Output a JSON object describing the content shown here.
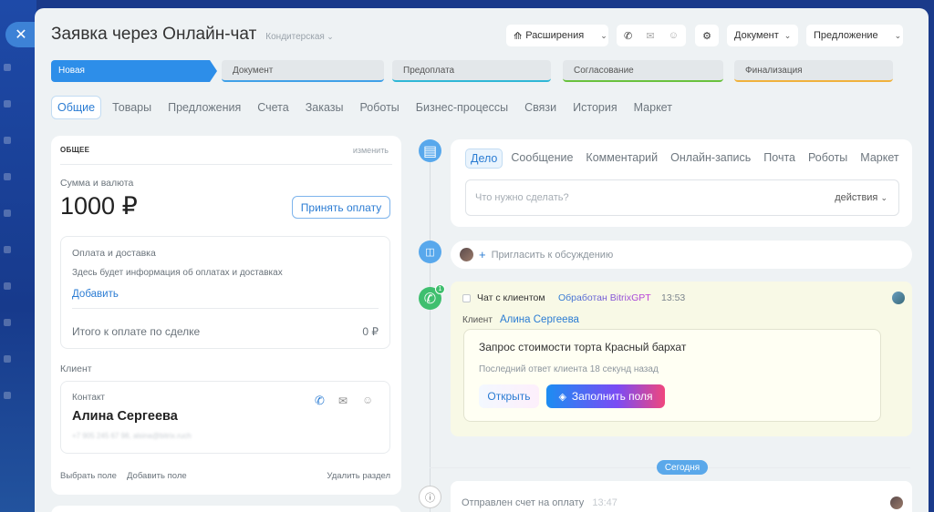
{
  "window": {
    "title": "Заявка через Онлайн-чат",
    "category": "Кондитерская"
  },
  "toolbar": {
    "extensions": "Расширения",
    "document": "Документ",
    "proposal": "Предложение"
  },
  "stages": [
    "Новая",
    "Документ",
    "Предоплата",
    "Согласование",
    "Финализация"
  ],
  "stage_colors": [
    "#2d8ee9",
    "#3fa0e8",
    "#2fb7d6",
    "#69c23d",
    "#f0b23c"
  ],
  "tabs": [
    "Общие",
    "Товары",
    "Предложения",
    "Счета",
    "Заказы",
    "Роботы",
    "Бизнес-процессы",
    "Связи",
    "История",
    "Маркет"
  ],
  "left": {
    "section_title": "ОБЩЕЕ",
    "edit_label": "изменить",
    "amount_label": "Сумма и валюта",
    "amount": "1000 ₽",
    "accept_payment": "Принять оплату",
    "payment_title": "Оплата и доставка",
    "payment_info": "Здесь будет информация об оплатах и доставках",
    "add_link": "Добавить",
    "total_label": "Итого к оплате по сделке",
    "total_value": "0 ₽",
    "client_label": "Клиент",
    "contact_label": "Контакт",
    "contact_name": "Алина Сергеева",
    "contact_details": "+7 905 245 67 98, alsina@bitrix.ruch",
    "choose_field": "Выбрать поле",
    "add_field": "Добавить поле",
    "delete_section": "Удалить раздел"
  },
  "activity": {
    "tabs": [
      "Дело",
      "Сообщение",
      "Комментарий",
      "Онлайн-запись",
      "Почта",
      "Роботы",
      "Маркет"
    ],
    "todo_placeholder": "Что нужно сделать?",
    "actions_label": "действия",
    "invite_label": "Пригласить к обсуждению"
  },
  "chat": {
    "badge": "1",
    "title": "Чат с клиентом",
    "processed": "Обработан BitrixGPT",
    "time": "13:53",
    "client_label": "Клиент",
    "client_name": "Алина Сергеева",
    "request": "Запрос стоимости торта Красный бархат",
    "last_reply": "Последний ответ клиента 18 секунд назад",
    "open": "Открыть",
    "fill": "Заполнить поля"
  },
  "today_label": "Сегодня",
  "invoice": {
    "text": "Отправлен счет на оплату",
    "time": "13:47"
  }
}
